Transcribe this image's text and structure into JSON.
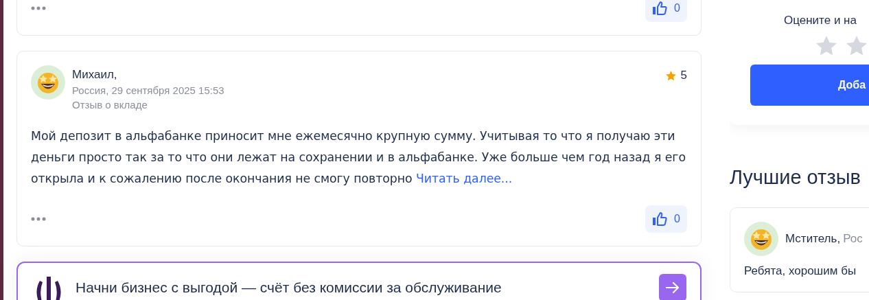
{
  "reviews": [
    {
      "kind": "partial",
      "likes": "0"
    },
    {
      "kind": "full",
      "author": "Михаил,",
      "meta": "Россия, 29 сентября 2025 15:53",
      "topic": "Отзыв о вкладе",
      "rating": "5",
      "text": "Мой депозит в альфабанке приносит мне ежемесячно крупную сумму. Учитывая то что я получаю эти деньги просто так за то что они лежат на сохранении и в альфабанке. Уже больше чем год назад я его открыла и к сожалению после окончания не смогу повторно",
      "read_more": "Читать далее...",
      "likes": "0"
    }
  ],
  "promo": {
    "text": "Начни бизнес с выгодой — счёт без комиссии за обслуживание"
  },
  "rating_widget": {
    "prompt": "Оцените и на",
    "button": "Доба"
  },
  "best_reviews": {
    "title": "Лучшие отзыв",
    "items": [
      {
        "author": "Мститель,",
        "location": "Рос",
        "text": "Ребята, хорошим бы"
      }
    ]
  }
}
